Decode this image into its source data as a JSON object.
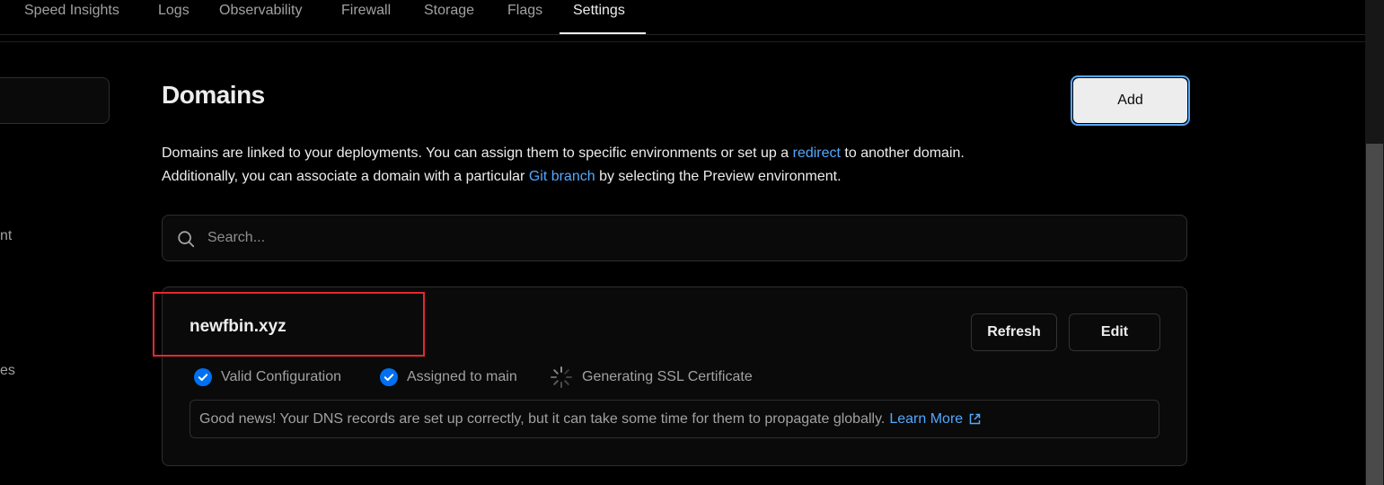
{
  "nav": {
    "tabs": [
      {
        "label": "Speed Insights"
      },
      {
        "label": "Logs"
      },
      {
        "label": "Observability"
      },
      {
        "label": "Firewall"
      },
      {
        "label": "Storage"
      },
      {
        "label": "Flags"
      },
      {
        "label": "Settings",
        "active": true
      }
    ]
  },
  "sidebar": {
    "partial_items": [
      "nt",
      "es"
    ]
  },
  "domains": {
    "title": "Domains",
    "add_label": "Add",
    "description": {
      "line1_a": "Domains are linked to your deployments. You can assign them to specific environments or set up a ",
      "line1_link": "redirect",
      "line1_b": " to another domain.",
      "line2_a": "Additionally, you can associate a domain with a particular ",
      "line2_link": "Git branch",
      "line2_b": " by selecting the Preview environment."
    },
    "search": {
      "placeholder": "Search..."
    },
    "items": [
      {
        "name": "newfbin.xyz",
        "refresh_label": "Refresh",
        "edit_label": "Edit",
        "statuses": [
          {
            "label": "Valid Configuration",
            "icon": "check-circle-icon"
          },
          {
            "label": "Assigned to main",
            "icon": "check-circle-icon"
          },
          {
            "label": "Generating SSL Certificate",
            "icon": "spinner-icon"
          }
        ],
        "notice": "Good news! Your DNS records are set up correctly, but it can take some time for them to propagate globally.",
        "learn_more": "Learn More"
      }
    ]
  },
  "colors": {
    "background": "#000000",
    "link": "#52a8ff",
    "check": "#0070f3",
    "highlight": "#e5282d"
  }
}
